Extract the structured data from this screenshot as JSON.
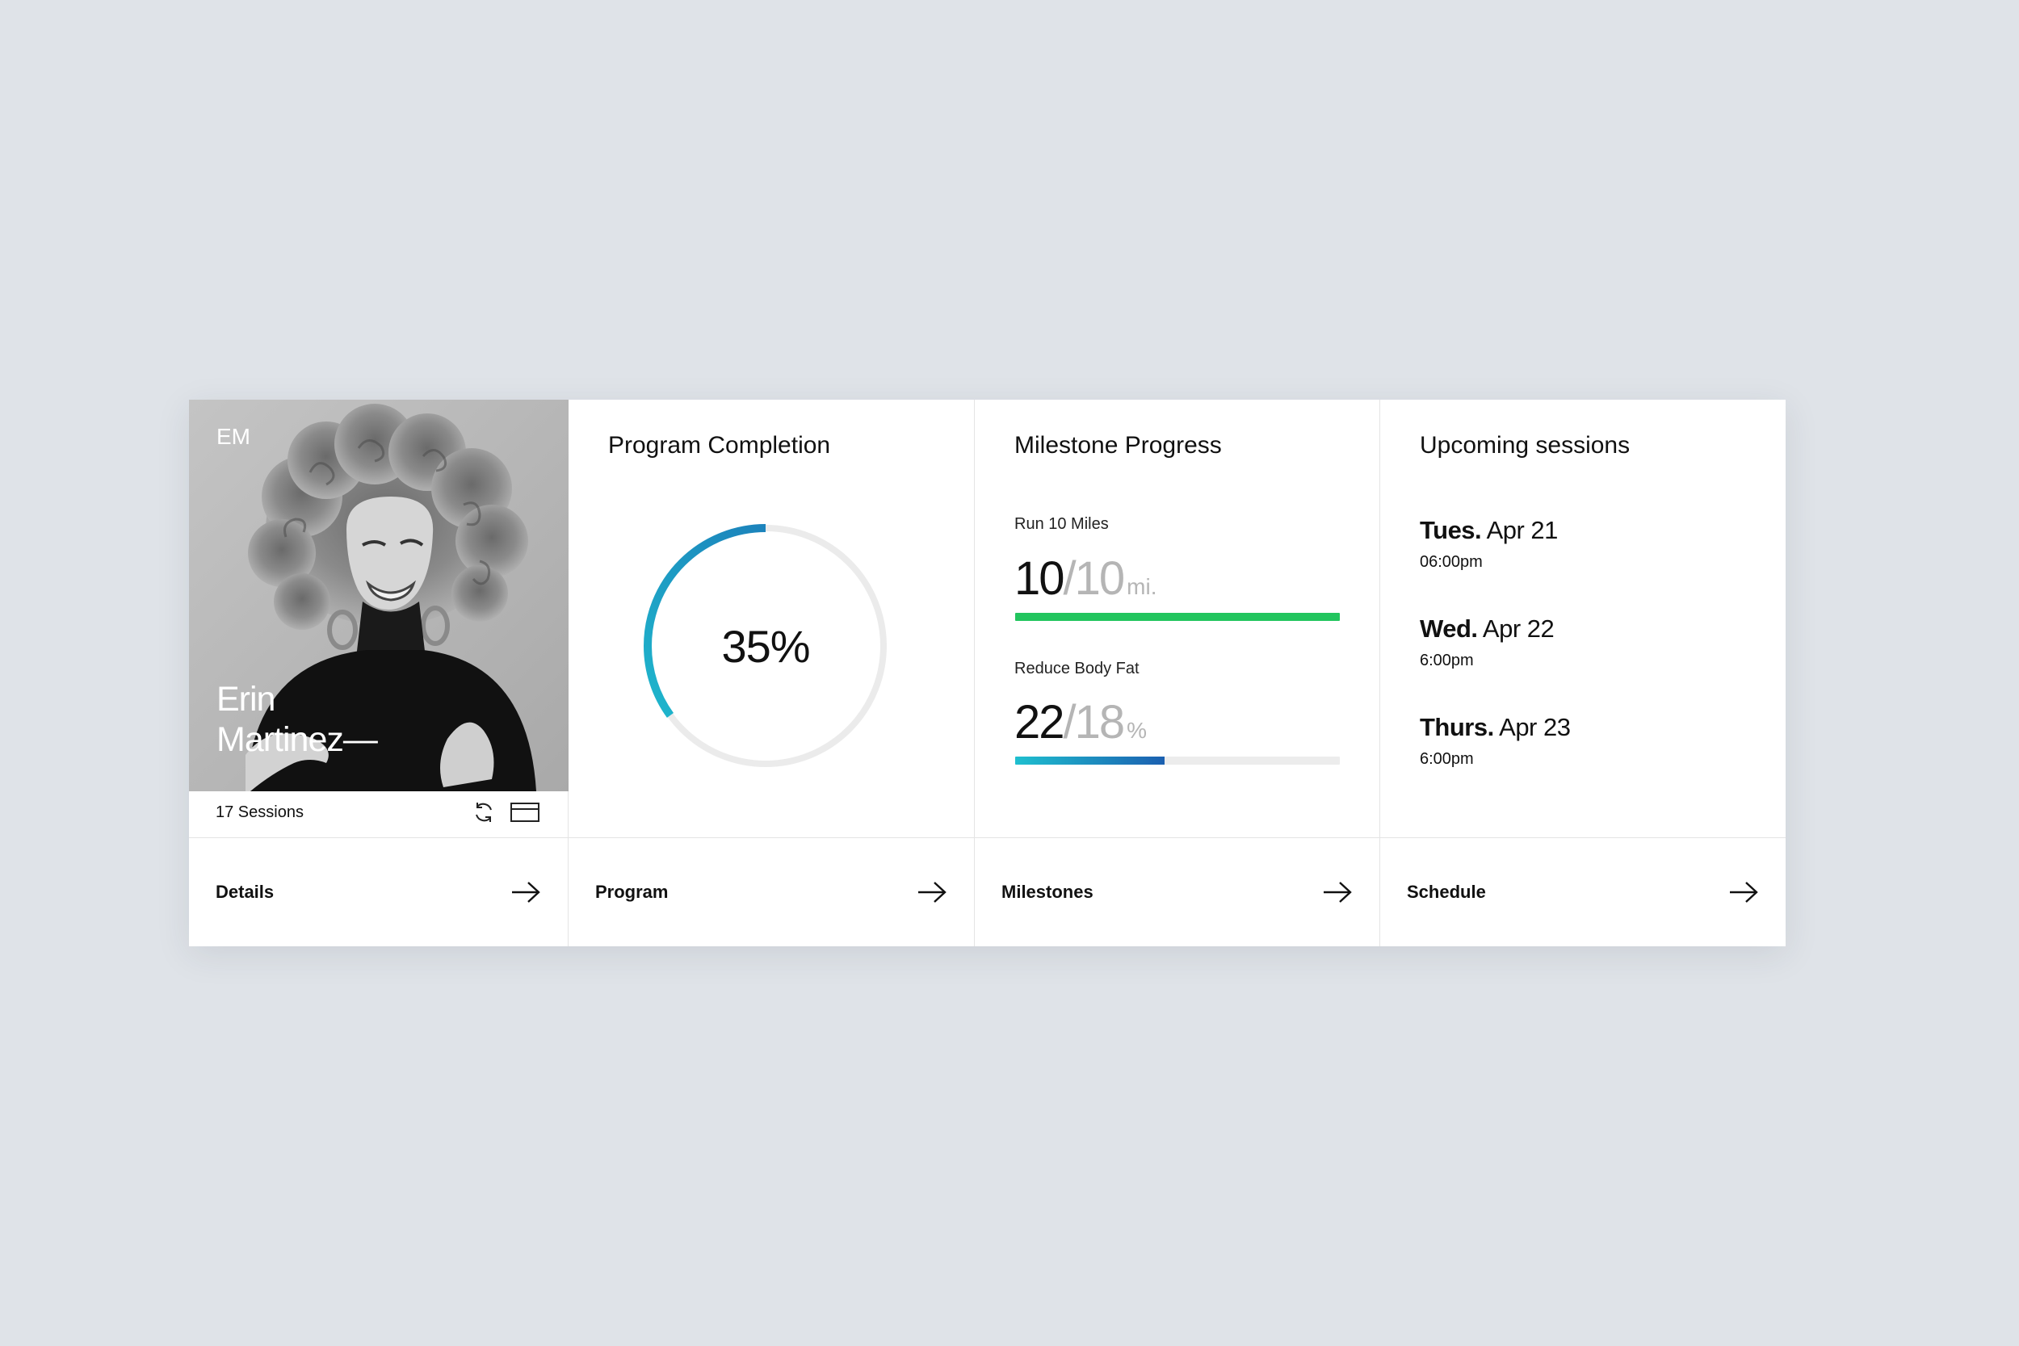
{
  "profile": {
    "initials": "EM",
    "name_line1": "Erin",
    "name_line2": "Martinez—",
    "sessions": "17 Sessions",
    "footer_label": "Details",
    "icons": [
      "refresh-icon",
      "card-icon",
      "arrow-right-icon"
    ]
  },
  "completion": {
    "title": "Program Completion",
    "percent_text": "35%",
    "percent": 35,
    "footer_label": "Program"
  },
  "milestones": {
    "title": "Milestone Progress",
    "items": [
      {
        "label": "Run 10 Miles",
        "current": "10",
        "target": "10",
        "unit": "mi.",
        "progress": 1.0
      },
      {
        "label": "Reduce Body Fat",
        "current": "22",
        "target": "18",
        "unit": "%",
        "progress": 0.46
      }
    ],
    "footer_label": "Milestones"
  },
  "schedule": {
    "title": "Upcoming sessions",
    "items": [
      {
        "day": "Tues.",
        "date": "Apr 21",
        "time": "06:00pm"
      },
      {
        "day": "Wed.",
        "date": "Apr 22",
        "time": "6:00pm"
      },
      {
        "day": "Thurs.",
        "date": "Apr 23",
        "time": "6:00pm"
      }
    ],
    "footer_label": "Schedule"
  },
  "colors": {
    "background": "#dfe3e8",
    "ring_start": "#1fbfcf",
    "ring_end": "#1b6fb5",
    "ring_track": "#ebebeb",
    "milestone_complete": "#22c55e",
    "milestone_gradient_start": "#1fbfcf",
    "milestone_gradient_end": "#1b5fb0"
  }
}
